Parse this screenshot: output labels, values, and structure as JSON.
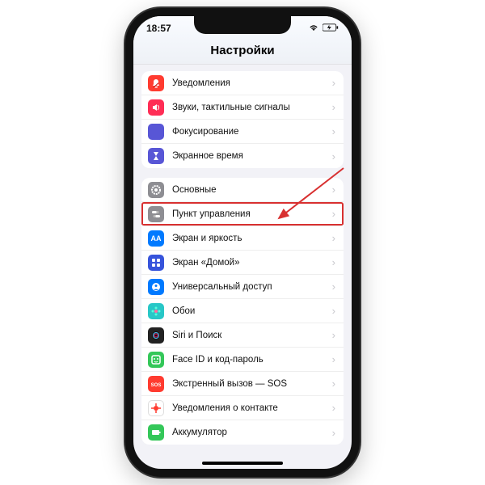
{
  "statusbar": {
    "time": "18:57"
  },
  "header": {
    "title": "Настройки"
  },
  "groups": [
    {
      "items": [
        {
          "id": "notifications",
          "label": "Уведомления",
          "icon": "bell",
          "bg": "#ff3b30"
        },
        {
          "id": "sounds",
          "label": "Звуки, тактильные сигналы",
          "icon": "speaker",
          "bg": "#ff2d55"
        },
        {
          "id": "focus",
          "label": "Фокусирование",
          "icon": "moon",
          "bg": "#5856d6"
        },
        {
          "id": "screentime",
          "label": "Экранное время",
          "icon": "hourglass",
          "bg": "#5856d6"
        }
      ]
    },
    {
      "items": [
        {
          "id": "general",
          "label": "Основные",
          "icon": "gear",
          "bg": "#8e8e93"
        },
        {
          "id": "control-center",
          "label": "Пункт управления",
          "icon": "switches",
          "bg": "#8e8e93",
          "highlight": true
        },
        {
          "id": "display",
          "label": "Экран и яркость",
          "icon": "aa",
          "bg": "#007aff"
        },
        {
          "id": "home",
          "label": "Экран «Домой»",
          "icon": "grid",
          "bg": "#3754db"
        },
        {
          "id": "accessibility",
          "label": "Универсальный доступ",
          "icon": "person",
          "bg": "#007aff"
        },
        {
          "id": "wallpaper",
          "label": "Обои",
          "icon": "flower",
          "bg": "#28c7c7"
        },
        {
          "id": "siri",
          "label": "Siri и Поиск",
          "icon": "siri",
          "bg": "#222"
        },
        {
          "id": "faceid",
          "label": "Face ID и код-пароль",
          "icon": "face",
          "bg": "#34c759"
        },
        {
          "id": "sos",
          "label": "Экстренный вызов — SOS",
          "icon": "sos",
          "bg": "#ff3b30"
        },
        {
          "id": "exposure",
          "label": "Уведомления о контакте",
          "icon": "virus",
          "bg": "#fff",
          "border": true
        },
        {
          "id": "battery",
          "label": "Аккумулятор",
          "icon": "battery",
          "bg": "#34c759"
        }
      ]
    }
  ],
  "arrow_target": "control-center"
}
